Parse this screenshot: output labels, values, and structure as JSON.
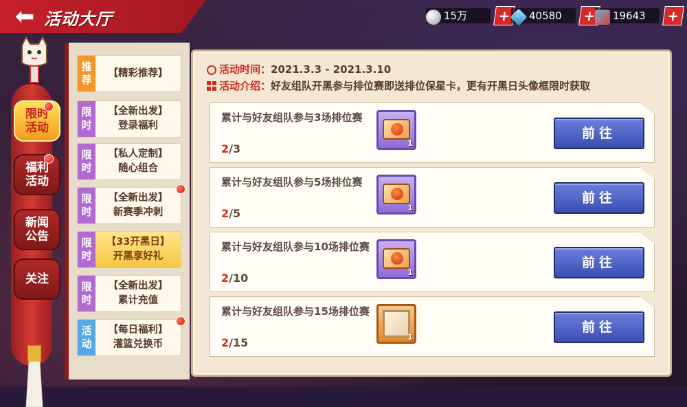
{
  "header": {
    "title": "活动大厅",
    "back_icon": "back-arrow-icon",
    "resources": [
      {
        "name": "coin",
        "icon": "coin-icon",
        "value": "15万"
      },
      {
        "name": "diamond",
        "icon": "diamond-icon",
        "value": "40580"
      },
      {
        "name": "ticket",
        "icon": "ticket-icon",
        "value": "19643"
      }
    ],
    "plus_label": "+"
  },
  "side_tabs": [
    {
      "label": "限时活动",
      "active": true,
      "badge": true
    },
    {
      "label": "福利活动",
      "active": false,
      "badge": true
    },
    {
      "label": "新闻公告",
      "active": false,
      "badge": false
    },
    {
      "label": "关注",
      "active": false,
      "badge": false
    }
  ],
  "activity_list": [
    {
      "tag": "推荐",
      "tag_color": "orange",
      "line1": "【精彩推荐】",
      "line2": "",
      "active": false,
      "badge": false
    },
    {
      "tag": "限时",
      "tag_color": "purple",
      "line1": "【全新出发】",
      "line2": "登录福利",
      "active": false,
      "badge": false
    },
    {
      "tag": "限时",
      "tag_color": "purple",
      "line1": "【私人定制】",
      "line2": "随心组合",
      "active": false,
      "badge": false
    },
    {
      "tag": "限时",
      "tag_color": "purple",
      "line1": "【全新出发】",
      "line2": "新赛季冲刺",
      "active": false,
      "badge": true
    },
    {
      "tag": "限时",
      "tag_color": "purple",
      "line1": "【33开黑日】",
      "line2": "开黑享好礼",
      "active": true,
      "badge": false
    },
    {
      "tag": "限时",
      "tag_color": "purple",
      "line1": "【全新出发】",
      "line2": "累计充值",
      "active": false,
      "badge": false
    },
    {
      "tag": "活动",
      "tag_color": "blue",
      "line1": "【每日福利】",
      "line2": "灌篮兑换币",
      "active": false,
      "badge": true
    }
  ],
  "detail": {
    "time_label": "活动时间：",
    "time_value": "2021.3.3 - 2021.3.10",
    "intro_label": "活动介绍：",
    "intro_value": "好友组队开黑参与排位赛即送排位保星卡，更有开黑日头像框限时获取",
    "tasks": [
      {
        "text": "累计与好友组队参与3场排位赛",
        "current": "2",
        "total": "/3",
        "reward": "star-card-icon",
        "qty": "1",
        "button": "前往"
      },
      {
        "text": "累计与好友组队参与5场排位赛",
        "current": "2",
        "total": "/5",
        "reward": "star-card-icon",
        "qty": "1",
        "button": "前往"
      },
      {
        "text": "累计与好友组队参与10场排位赛",
        "current": "2",
        "total": "/10",
        "reward": "star-card-icon",
        "qty": "1",
        "button": "前往"
      },
      {
        "text": "累计与好友组队参与15场排位赛",
        "current": "2",
        "total": "/15",
        "reward": "avatar-frame-icon",
        "qty": "1",
        "button": "前往"
      }
    ]
  },
  "colors": {
    "accent_red": "#d22a1e",
    "button_blue": "#3a4eb0",
    "active_gold": "#f6c744"
  }
}
